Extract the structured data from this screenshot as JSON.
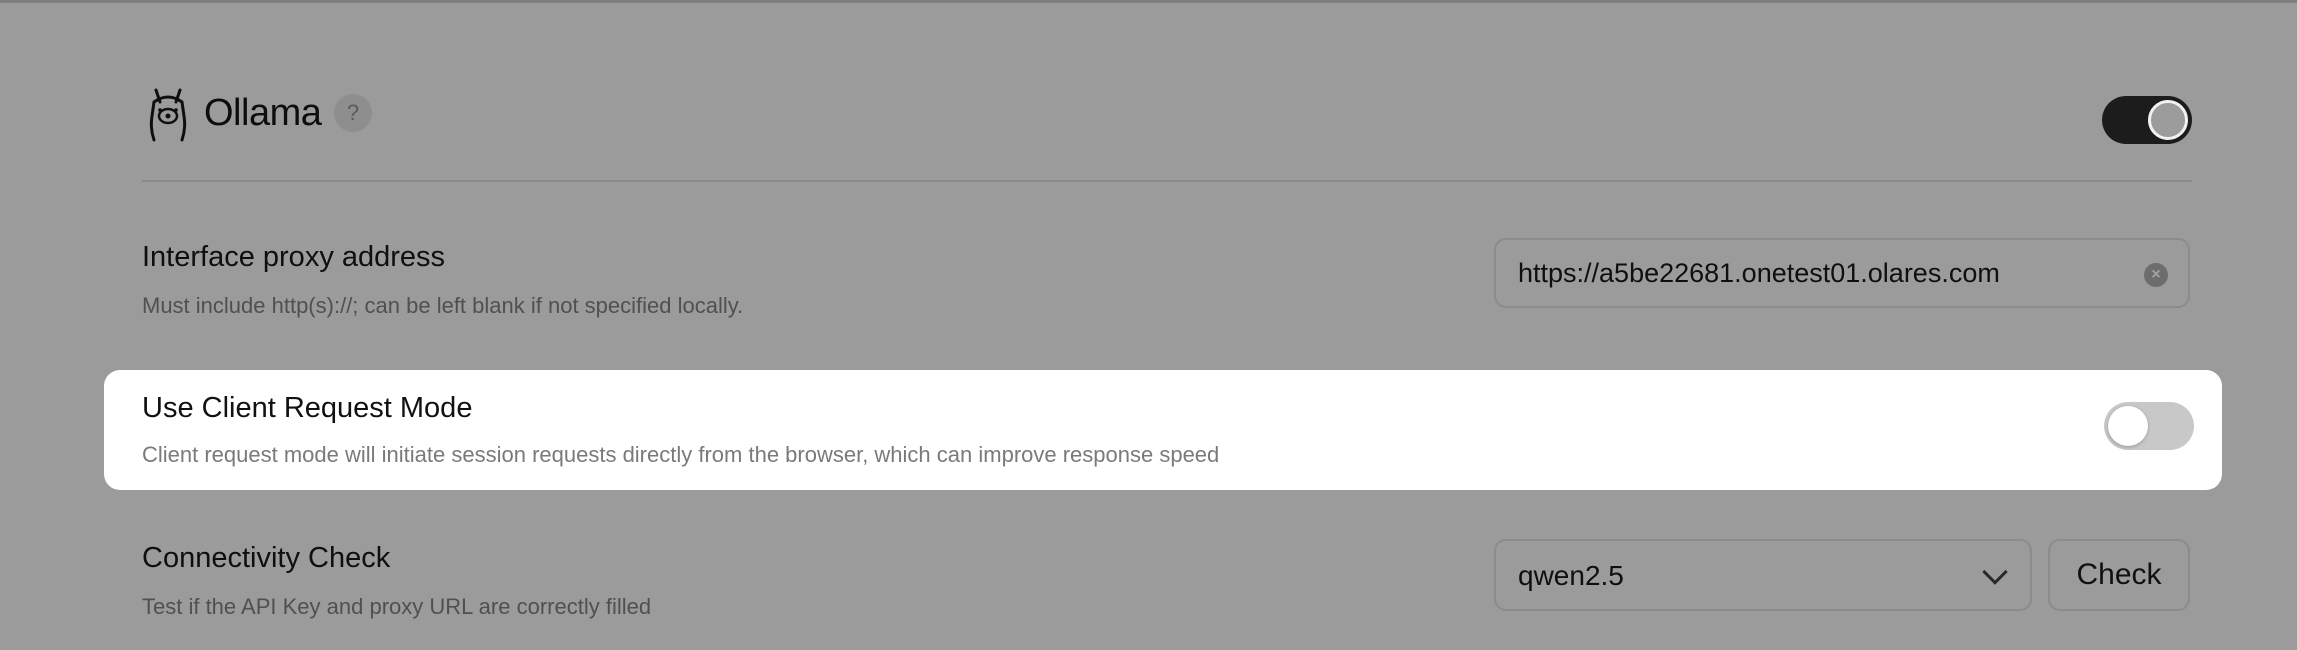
{
  "provider": {
    "name": "Ollama",
    "help_symbol": "?",
    "enabled": true
  },
  "proxy": {
    "title": "Interface proxy address",
    "description": "Must include http(s)://; can be left blank if not specified locally.",
    "value": "https://a5be22681.onetest01.olares.com"
  },
  "client_request_mode": {
    "title": "Use Client Request Mode",
    "description": "Client request mode will initiate session requests directly from the browser, which can improve response speed",
    "enabled": false
  },
  "connectivity": {
    "title": "Connectivity Check",
    "description": "Test if the API Key and proxy URL are correctly filled",
    "selected_model": "qwen2.5",
    "check_label": "Check"
  },
  "icons": {
    "logo": "llama-logo-icon",
    "help": "help-icon",
    "clear": "clear-icon",
    "dropdown": "chevron-down-icon"
  }
}
